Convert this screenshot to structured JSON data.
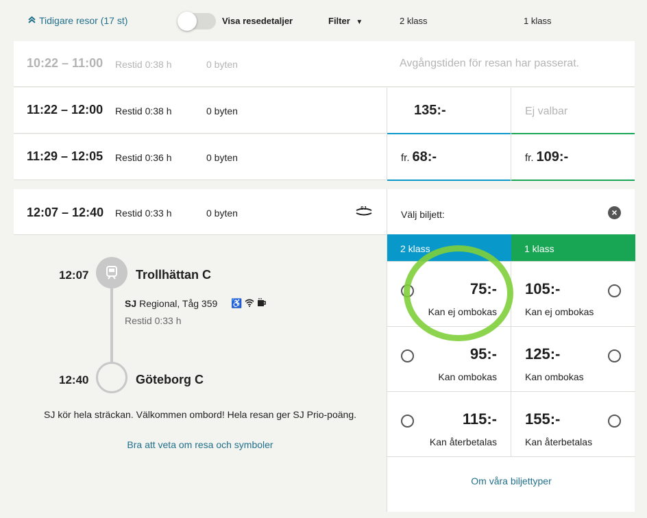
{
  "topbar": {
    "previous_trips": "Tidigare resor (17 st)",
    "toggle_label": "Visa resedetaljer",
    "filter": "Filter",
    "col_second_class": "2 klass",
    "col_first_class": "1 klass"
  },
  "rows": [
    {
      "time": "10:22 – 11:00",
      "duration": "Restid 0:38 h",
      "changes": "0 byten",
      "message": "Avgångstiden för resan har passerat."
    },
    {
      "time": "11:22 – 12:00",
      "duration": "Restid 0:38 h",
      "changes": "0 byten",
      "price_2": "135:-",
      "price_1": "Ej valbar"
    },
    {
      "time": "11:29 – 12:05",
      "duration": "Restid 0:36 h",
      "changes": "0 byten",
      "prefix": "fr.",
      "price_2": "68:-",
      "price_1": "109:-"
    }
  ],
  "selected": {
    "time": "12:07 – 12:40",
    "duration": "Restid 0:33 h",
    "changes": "0 byten",
    "operator_logo": "SJ",
    "from_time": "12:07",
    "from_station": "Trollhättan C",
    "operator": "SJ",
    "train": "Regional, Tåg 359",
    "amenity_icons": [
      "wheelchair-icon",
      "wifi-icon",
      "coffee-icon"
    ],
    "leg_duration": "Restid 0:33 h",
    "to_time": "12:40",
    "to_station": "Göteborg C",
    "note": "SJ kör hela sträckan. Välkommen ombord! Hela resan ger SJ Prio-poäng.",
    "info_link": "Bra att veta om resa och symboler"
  },
  "tickets": {
    "choose_label": "Välj biljett:",
    "tab_2": "2 klass",
    "tab_1": "1 klass",
    "tab_2_color": "#0898c9",
    "tab_1_color": "#19a654",
    "options": [
      {
        "price_2": "75:-",
        "price_1": "105:-",
        "label": "Kan ej ombokas"
      },
      {
        "price_2": "95:-",
        "price_1": "125:-",
        "label": "Kan ombokas"
      },
      {
        "price_2": "115:-",
        "price_1": "155:-",
        "label": "Kan återbetalas"
      }
    ],
    "types_link": "Om våra biljettyper"
  }
}
